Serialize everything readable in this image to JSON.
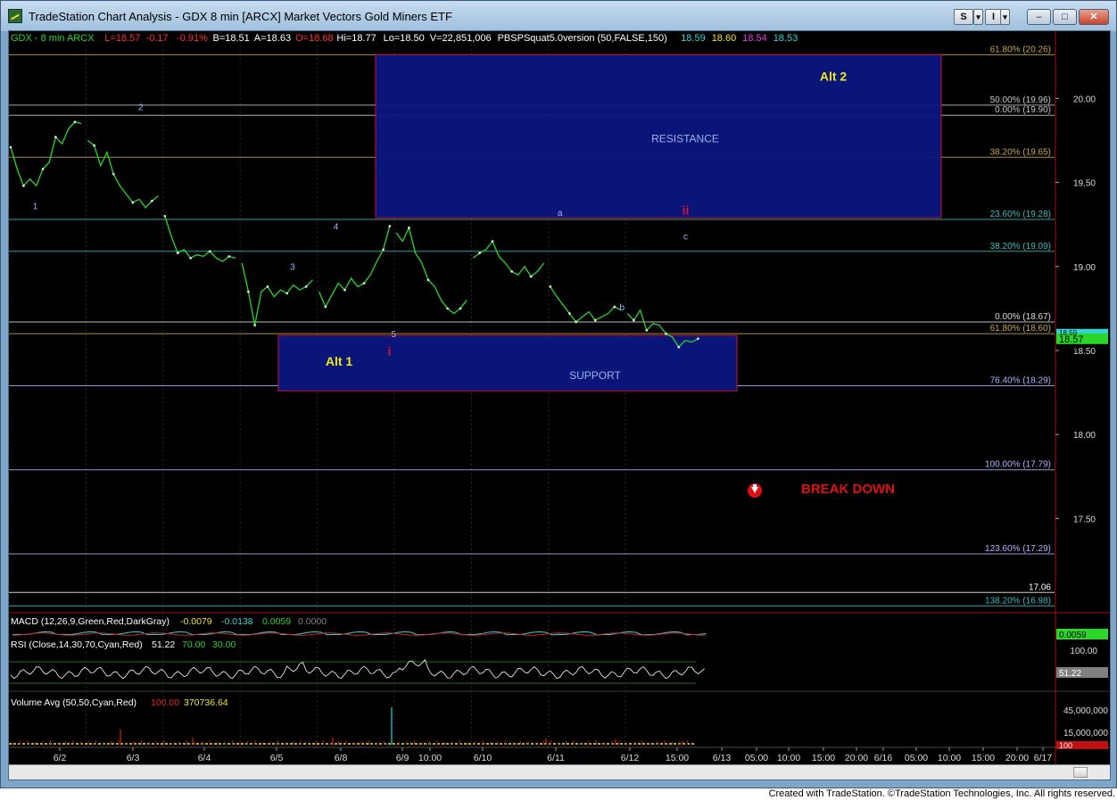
{
  "window": {
    "title": "TradeStation Chart Analysis - GDX 8 min [ARCX] Market Vectors Gold Miners ETF",
    "buttons": {
      "s": "S",
      "i": "I",
      "dropdown": "▾",
      "minimize": "–",
      "maximize": "□",
      "close": "✕"
    }
  },
  "colors": {
    "background": "#000000",
    "price": "#29d629",
    "rsi": "#ffffff",
    "box_fill": "#0a1680",
    "box_border": "#d01030",
    "alt_label": "#f2e61d",
    "break_down": "#e01010",
    "fib_text": "#c8c070"
  },
  "status_line": [
    {
      "text": "GDX - 8 min  ARCX",
      "color": "#29d629"
    },
    {
      "text": "L=18.57",
      "color": "#ff3030"
    },
    {
      "text": "-0.17",
      "color": "#ff3030"
    },
    {
      "text": "-0.91%",
      "color": "#ff3030"
    },
    {
      "text": "B=18.51",
      "color": "#ffffff"
    },
    {
      "text": "A=18.63",
      "color": "#ffffff"
    },
    {
      "text": "O=18.68",
      "color": "#ff3030"
    },
    {
      "text": "Hi=18.77",
      "color": "#ffffff"
    },
    {
      "text": "Lo=18.50",
      "color": "#ffffff"
    },
    {
      "text": "V=22,851,006",
      "color": "#ffffff"
    },
    {
      "text": "PBSPSquat5.0version (50,FALSE,150)",
      "color": "#ffffff"
    },
    {
      "text": "18.59",
      "color": "#2fd6d6"
    },
    {
      "text": "18.60",
      "color": "#f2e61d"
    },
    {
      "text": "18.54",
      "color": "#e040e0"
    },
    {
      "text": "18.53",
      "color": "#2fd6d6"
    }
  ],
  "chart_data": {
    "type": "line",
    "symbol": "GDX",
    "interval": "8 min",
    "ylim": [
      16.95,
      20.4
    ],
    "y_ticks": [
      "20.00",
      "19.50",
      "19.00",
      "18.50",
      "18.00",
      "17.50"
    ],
    "x_ticks": [
      "6/2",
      "6/3",
      "6/4",
      "6/5",
      "6/8",
      "6/9",
      "10:00",
      "6/10",
      "6/11",
      "6/12",
      "15:00",
      "6/13",
      "05:00",
      "10:00",
      "15:00",
      "20:00",
      "6/16",
      "05:00",
      "10:00",
      "15:00",
      "20:00",
      "6/17"
    ],
    "last_price": "18.57",
    "last_price_overlays": [
      "18.59",
      "18.54"
    ],
    "price_series": [
      {
        "session": "6/2",
        "x": [
          0,
          1,
          2,
          3,
          4,
          5,
          6,
          7,
          8,
          9,
          10,
          11
        ],
        "close": [
          19.71,
          19.58,
          19.48,
          19.52,
          19.48,
          19.58,
          19.62,
          19.77,
          19.73,
          19.82,
          19.86,
          19.85
        ]
      },
      {
        "session": "6/3",
        "x": [
          12,
          13,
          14,
          15,
          16,
          17,
          18,
          19,
          20,
          21,
          22,
          23
        ],
        "close": [
          19.75,
          19.72,
          19.6,
          19.68,
          19.55,
          19.48,
          19.43,
          19.38,
          19.4,
          19.35,
          19.39,
          19.42
        ]
      },
      {
        "session": "6/4",
        "x": [
          24,
          25,
          26,
          27,
          28,
          29,
          30,
          31,
          32,
          33,
          34,
          35
        ],
        "close": [
          19.3,
          19.18,
          19.08,
          19.1,
          19.05,
          19.07,
          19.06,
          19.09,
          19.05,
          19.03,
          19.06,
          19.05
        ]
      },
      {
        "session": "6/5",
        "x": [
          36,
          37,
          38,
          39,
          40,
          41,
          42,
          43,
          44,
          45,
          46,
          47
        ],
        "close": [
          19.02,
          18.85,
          18.65,
          18.85,
          18.88,
          18.82,
          18.86,
          18.84,
          18.89,
          18.86,
          18.88,
          18.92
        ]
      },
      {
        "session": "6/8",
        "x": [
          48,
          49,
          50,
          51,
          52,
          53,
          54,
          55,
          56,
          57,
          58,
          59
        ],
        "close": [
          18.85,
          18.76,
          18.83,
          18.9,
          18.86,
          18.93,
          18.88,
          18.9,
          18.95,
          19.03,
          19.1,
          19.24
        ]
      },
      {
        "session": "6/9",
        "x": [
          60,
          61,
          62,
          63,
          64,
          65,
          66,
          67,
          68,
          69,
          70,
          71
        ],
        "close": [
          19.2,
          19.15,
          19.23,
          19.08,
          19.02,
          18.92,
          18.88,
          18.8,
          18.75,
          18.72,
          18.75,
          18.8
        ]
      },
      {
        "session": "6/10",
        "x": [
          72,
          73,
          74,
          75,
          76,
          77,
          78,
          79,
          80,
          81,
          82,
          83
        ],
        "close": [
          19.05,
          19.08,
          19.1,
          19.15,
          19.06,
          19.02,
          18.97,
          18.95,
          19.0,
          18.94,
          18.97,
          19.02
        ]
      },
      {
        "session": "6/11",
        "x": [
          84,
          85,
          86,
          87,
          88,
          89,
          90,
          91,
          92,
          93,
          94,
          95
        ],
        "close": [
          18.88,
          18.82,
          18.77,
          18.72,
          18.67,
          18.7,
          18.73,
          18.68,
          18.7,
          18.72,
          18.76,
          18.74
        ]
      },
      {
        "session": "6/12",
        "x": [
          96,
          97,
          98,
          99,
          100,
          101,
          102,
          103,
          104,
          105,
          106,
          107
        ],
        "close": [
          18.72,
          18.68,
          18.74,
          18.62,
          18.66,
          18.65,
          18.6,
          18.58,
          18.52,
          18.56,
          18.55,
          18.57
        ]
      }
    ],
    "price_points": [
      {
        "x": 0,
        "close": 19.71
      },
      {
        "x": 2,
        "close": 19.48
      },
      {
        "x": 5,
        "close": 19.58
      },
      {
        "x": 7,
        "close": 19.77
      },
      {
        "x": 10,
        "close": 19.86
      },
      {
        "x": 13,
        "close": 19.72
      },
      {
        "x": 16,
        "close": 19.55
      },
      {
        "x": 19,
        "close": 19.38
      },
      {
        "x": 22,
        "close": 19.39
      },
      {
        "x": 24,
        "close": 19.3
      },
      {
        "x": 26,
        "close": 19.08
      },
      {
        "x": 28,
        "close": 19.05
      },
      {
        "x": 31,
        "close": 19.09
      },
      {
        "x": 34,
        "close": 19.06
      },
      {
        "x": 37,
        "close": 18.85
      },
      {
        "x": 38,
        "close": 18.65
      },
      {
        "x": 40,
        "close": 18.88
      },
      {
        "x": 43,
        "close": 18.84
      },
      {
        "x": 46,
        "close": 18.88
      },
      {
        "x": 49,
        "close": 18.76
      },
      {
        "x": 52,
        "close": 18.86
      },
      {
        "x": 55,
        "close": 18.9
      },
      {
        "x": 58,
        "close": 19.1
      },
      {
        "x": 59,
        "close": 19.24
      },
      {
        "x": 62,
        "close": 19.23
      },
      {
        "x": 65,
        "close": 18.92
      },
      {
        "x": 68,
        "close": 18.75
      },
      {
        "x": 70,
        "close": 18.75
      },
      {
        "x": 73,
        "close": 19.08
      },
      {
        "x": 75,
        "close": 19.15
      },
      {
        "x": 78,
        "close": 18.97
      },
      {
        "x": 81,
        "close": 18.94
      },
      {
        "x": 84,
        "close": 18.88
      },
      {
        "x": 87,
        "close": 18.72
      },
      {
        "x": 88,
        "close": 18.67
      },
      {
        "x": 91,
        "close": 18.68
      },
      {
        "x": 94,
        "close": 18.76
      },
      {
        "x": 97,
        "close": 18.68
      },
      {
        "x": 99,
        "close": 18.62
      },
      {
        "x": 102,
        "close": 18.6
      },
      {
        "x": 104,
        "close": 18.52
      },
      {
        "x": 107,
        "close": 18.57
      }
    ],
    "fib_levels": [
      {
        "label": "61.80% (20.26)",
        "value": 20.26,
        "color": "#c8a83c"
      },
      {
        "label": "50.00% (19.96)",
        "value": 19.96,
        "color": "#c8c8c8"
      },
      {
        "label": "0.00% (19.90)",
        "value": 19.9,
        "color": "#c8c8c8"
      },
      {
        "label": "38.20% (19.65)",
        "value": 19.65,
        "color": "#c8a83c"
      },
      {
        "label": "23.60% (19.28)",
        "value": 19.28,
        "color": "#2fbfbf"
      },
      {
        "label": "38.20% (19.09)",
        "value": 19.09,
        "color": "#2fbfbf"
      },
      {
        "label": "0.00% (18.67)",
        "value": 18.67,
        "color": "#dcdcdc"
      },
      {
        "label": "61.80% (18.60)",
        "value": 18.6,
        "color": "#c8a83c"
      },
      {
        "label": "76.40% (18.29)",
        "value": 18.29,
        "color": "#b0b0ff"
      },
      {
        "label": "100.00% (17.79)",
        "value": 17.79,
        "color": "#b0b0ff"
      },
      {
        "label": "123.60% (17.29)",
        "value": 17.29,
        "color": "#b0b0ff"
      },
      {
        "label": "138.20% (16.98)",
        "value": 16.98,
        "color": "#2fbfbf"
      }
    ],
    "extra_level": {
      "label": "17.06",
      "value": 17.06
    },
    "wave_labels": [
      {
        "text": "2",
        "x": 9,
        "price": 19.93,
        "color": "#a0b0ff"
      },
      {
        "text": "1",
        "x": 1.7,
        "price": 19.34,
        "color": "#a0b0ff"
      },
      {
        "text": "3",
        "x": 19.5,
        "price": 18.98,
        "color": "#a0b0ff"
      },
      {
        "text": "4",
        "x": 22.5,
        "price": 19.22,
        "color": "#a0b0ff"
      },
      {
        "text": "5",
        "x": 26.5,
        "price": 18.58,
        "color": "#a0b0ff"
      },
      {
        "text": "i",
        "x": 26.2,
        "price": 18.47,
        "color": "#e01030"
      },
      {
        "text": "a",
        "x": 38,
        "price": 19.3,
        "color": "#a0b0ff"
      },
      {
        "text": "b",
        "x": 42.3,
        "price": 18.74,
        "color": "#a0b0ff"
      },
      {
        "text": "c",
        "x": 46.7,
        "price": 19.16,
        "color": "#a0b0ff"
      },
      {
        "text": "ii",
        "x": 46.7,
        "price": 19.31,
        "color": "#e01030"
      }
    ],
    "zones": [
      {
        "label": "RESISTANCE",
        "alt_label": "Alt 2",
        "top": 20.26,
        "bottom": 19.29
      },
      {
        "label": "SUPPORT",
        "alt_label": "Alt 1",
        "top": 18.59,
        "bottom": 18.26
      }
    ],
    "break_down_label": "BREAK DOWN",
    "macd": {
      "title": "MACD (12,26,9,Green,Red,DarkGray)",
      "values": [
        "-0.0079",
        "-0.0138",
        "0.0059",
        "0.0000"
      ],
      "last": "0.0059"
    },
    "rsi": {
      "title": "RSI (Close,14,30,70,Cyan,Red)",
      "values": [
        "51.22",
        "70.00",
        "30.00"
      ],
      "axis": "100.00",
      "last": "51.22"
    },
    "volume": {
      "title": "Volume Avg (50,50,Cyan,Red)",
      "values": [
        "100.00",
        "370736.64"
      ],
      "axis": [
        "45,000,000",
        "15,000,000",
        "100"
      ]
    }
  },
  "credit": "Created with TradeStation. ©TradeStation Technologies, Inc. All rights reserved."
}
